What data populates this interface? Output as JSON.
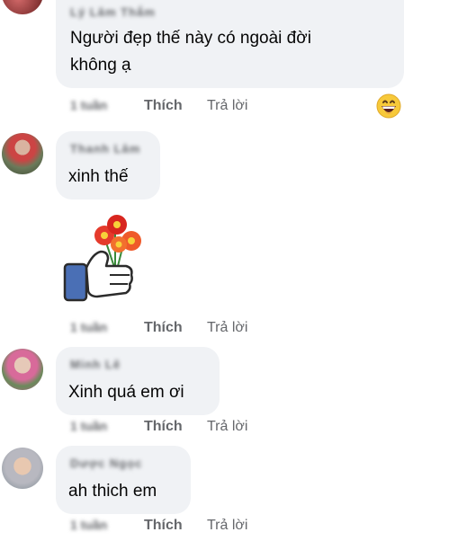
{
  "comments": [
    {
      "author": "Lý Lâm Thắm",
      "lines": [
        "Người đẹp thế này có ngoài đời",
        "không ạ"
      ],
      "time": "1 tuần"
    },
    {
      "author": "Thanh Lâm",
      "text": "xinh thế",
      "sticker": "thumbs-up-flowers",
      "time": "1 tuần"
    },
    {
      "author": "Minh Lê",
      "text": "Xinh quá em ơi",
      "time": "1 tuần"
    },
    {
      "author": "Dược Ngọc",
      "text": "ah thich em",
      "time": "1 tuần"
    }
  ],
  "labels": {
    "like": "Thích",
    "reply": "Trả lời"
  },
  "reaction": "grinning-face-emoji",
  "colors": {
    "bubble": "#f0f2f5",
    "meta_text": "#65676b",
    "thumb_blue": "#4267b2"
  }
}
